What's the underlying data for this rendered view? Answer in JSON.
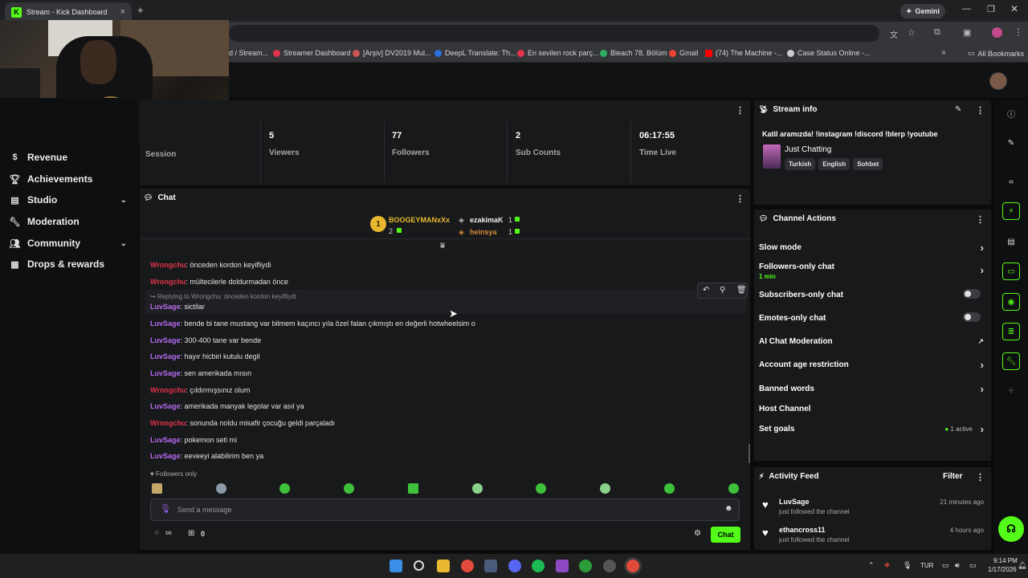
{
  "browser": {
    "tab_title": "Stream - Kick Dashboard",
    "tab_close": "×",
    "new_tab": "+",
    "gemini_label": "Gemini",
    "bookmarks": [
      {
        "label": "d / Stream...",
        "color": "#888888"
      },
      {
        "label": "Streamer Dashboard",
        "color": "#e0334a"
      },
      {
        "label": "[Arşiv] DV2019 Mul...",
        "color": "#c55"
      },
      {
        "label": "DeepL Translate: Th...",
        "color": "#2a6fdb"
      },
      {
        "label": "En sevilen rock parç...",
        "color": "#e0334a"
      },
      {
        "label": "Bleach 78. Bölüm",
        "color": "#2fae62"
      },
      {
        "label": "Gmail",
        "color": "#ea4335"
      },
      {
        "label": "(74) The Machine -...",
        "color": "#ff0000"
      },
      {
        "label": "Case Status Online -...",
        "color": "#cccccc"
      }
    ],
    "all_bookmarks": "All Bookmarks"
  },
  "sidebar": {
    "items": [
      {
        "label": "Revenue",
        "icon": "dollar-icon"
      },
      {
        "label": "Achievements",
        "icon": "trophy-icon"
      },
      {
        "label": "Studio",
        "icon": "studio-icon",
        "expandable": true
      },
      {
        "label": "Moderation",
        "icon": "wrench-icon"
      },
      {
        "label": "Community",
        "icon": "people-icon",
        "expandable": true
      },
      {
        "label": "Drops & rewards",
        "icon": "gift-icon"
      }
    ]
  },
  "stats": {
    "session_label": "Session",
    "items": [
      {
        "value": "5",
        "label": "Viewers"
      },
      {
        "value": "77",
        "label": "Followers"
      },
      {
        "value": "2",
        "label": "Sub Counts"
      },
      {
        "value": "06:17:55",
        "label": "Time Live"
      }
    ]
  },
  "chat": {
    "title": "Chat",
    "leaderboard": {
      "first": {
        "rank": "1",
        "name": "BOOGEYMANxXx",
        "count": "2"
      },
      "second": {
        "name": "ezakimaK",
        "count": "1"
      },
      "third": {
        "name": "heinsya",
        "count": "1"
      }
    },
    "reply_context": "Replying to Wrongchu: önceden kordon keyifliydi",
    "messages": [
      {
        "user": "Wrongchu",
        "text": ": önceden kordon keyifliydi",
        "color": "red"
      },
      {
        "user": "Wrongchu",
        "text": ": mültecilerle doldurmadan önce",
        "color": "red"
      },
      {
        "user": "LuvSage",
        "text": ": sictilar",
        "color": "purple"
      },
      {
        "user": "LuvSage",
        "text": ": bende bi tane mustang var bilmem kaçıncı yıla özel falan çıkmıştı en değerli hotwheelsim o",
        "color": "purple"
      },
      {
        "user": "LuvSage",
        "text": ": 300-400 tane var bende",
        "color": "purple"
      },
      {
        "user": "LuvSage",
        "text": ": hayır hicbiri kutulu degil",
        "color": "purple"
      },
      {
        "user": "LuvSage",
        "text": ": sen amerikada mısın",
        "color": "purple"
      },
      {
        "user": "Wrongchu",
        "text": ": çıldırmışsınız olum",
        "color": "red"
      },
      {
        "user": "LuvSage",
        "text": ": amerikada manyak legolar var asıl ya",
        "color": "purple"
      },
      {
        "user": "Wrongchu",
        "text": ": sonunda noldu misafir çocuğu geldi parçaladı",
        "color": "red"
      },
      {
        "user": "LuvSage",
        "text": ": pokemon seti mi",
        "color": "purple"
      },
      {
        "user": "LuvSage",
        "text": ": eeveeyi alabilirim ben ya",
        "color": "purple"
      }
    ],
    "followers_only": "Followers only",
    "input_placeholder": "Send a message",
    "infinity_count": "∞",
    "gift_count": "0",
    "send_label": "Chat"
  },
  "stream_info": {
    "title": "Stream info",
    "stream_title": "Katil aramızda! !instagram !discord !blerp !youtube",
    "category": "Just Chatting",
    "tags": [
      "Turkish",
      "English",
      "Sohbet"
    ]
  },
  "channel_actions": {
    "title": "Channel Actions",
    "slow_mode": "Slow mode",
    "followers_only": "Followers-only chat",
    "followers_only_duration": "1 min",
    "subscribers_only": "Subscribers-only chat",
    "emotes_only": "Emotes-only chat",
    "ai_moderation": "AI Chat Moderation",
    "account_age": "Account age restriction",
    "banned_words": "Banned words",
    "host_channel": "Host Channel",
    "set_goals": "Set goals",
    "goals_status": "1 active"
  },
  "activity_feed": {
    "title": "Activity Feed",
    "filter_label": "Filter",
    "items": [
      {
        "user": "LuvSage",
        "action": "just followed the channel",
        "time": "21 minutes ago"
      },
      {
        "user": "ethancross11",
        "action": "just followed the channel",
        "time": "4 hours ago"
      }
    ]
  },
  "taskbar": {
    "language": "TUR",
    "time": "9:14 PM",
    "date": "1/17/2026"
  },
  "colors": {
    "accent": "#53fc18",
    "panel": "#18191b",
    "bg": "#0b0b0c",
    "red_user": "#e0334a",
    "purple_user": "#b56cf0"
  }
}
